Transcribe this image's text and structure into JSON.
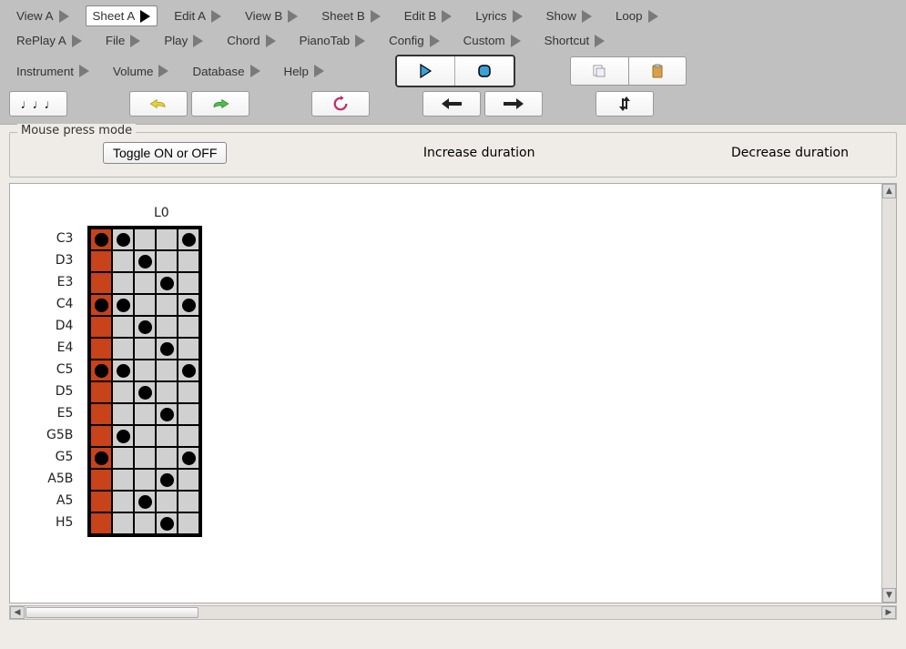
{
  "menus": {
    "row1": [
      "View A",
      "Sheet A",
      "Edit A",
      "View B",
      "Sheet B",
      "Edit B",
      "Lyrics",
      "Show",
      "Loop"
    ],
    "row2": [
      "RePlay A",
      "File",
      "Play",
      "Chord",
      "PianoTab",
      "Config",
      "Custom",
      "Shortcut"
    ],
    "row3": [
      "Instrument",
      "Volume",
      "Database",
      "Help"
    ],
    "active": "Sheet A"
  },
  "mode": {
    "legend": "Mouse press mode",
    "toggle_label": "Toggle ON or OFF",
    "increase_label": "Increase duration",
    "decrease_label": "Decrease duration"
  },
  "grid": {
    "column_header": "L0",
    "rows": [
      "C3",
      "D3",
      "E3",
      "C4",
      "D4",
      "E4",
      "C5",
      "D5",
      "E5",
      "G5B",
      "G5",
      "A5B",
      "A5",
      "H5"
    ],
    "cols": 5,
    "cells": [
      [
        {
          "red": true,
          "dot": true
        },
        {
          "dot": true
        },
        {},
        {},
        {
          "dot": true
        }
      ],
      [
        {
          "red": true
        },
        {},
        {
          "dot": true
        },
        {},
        {}
      ],
      [
        {
          "red": true
        },
        {},
        {},
        {
          "dot": true
        },
        {}
      ],
      [
        {
          "red": true,
          "dot": true
        },
        {
          "dot": true
        },
        {},
        {},
        {
          "dot": true
        }
      ],
      [
        {
          "red": true
        },
        {},
        {
          "dot": true
        },
        {},
        {}
      ],
      [
        {
          "red": true
        },
        {},
        {},
        {
          "dot": true
        },
        {}
      ],
      [
        {
          "red": true,
          "dot": true
        },
        {
          "dot": true
        },
        {},
        {},
        {
          "dot": true
        }
      ],
      [
        {
          "red": true
        },
        {},
        {
          "dot": true
        },
        {},
        {}
      ],
      [
        {
          "red": true
        },
        {},
        {},
        {
          "dot": true
        },
        {}
      ],
      [
        {
          "red": true
        },
        {
          "dot": true
        },
        {},
        {},
        {}
      ],
      [
        {
          "red": true,
          "dot": true
        },
        {},
        {},
        {},
        {
          "dot": true
        }
      ],
      [
        {
          "red": true
        },
        {},
        {},
        {
          "dot": true
        },
        {}
      ],
      [
        {
          "red": true
        },
        {},
        {
          "dot": true
        },
        {},
        {}
      ],
      [
        {
          "red": true
        },
        {},
        {},
        {
          "dot": true
        },
        {}
      ]
    ]
  },
  "colors": {
    "toolbar_bg": "#c0c0c0",
    "red_cell": "#c8421a",
    "grey_cell": "#d0d0d0"
  }
}
